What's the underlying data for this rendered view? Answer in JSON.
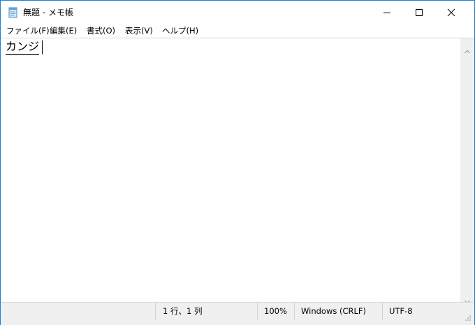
{
  "window": {
    "title": "無題 - メモ帳"
  },
  "menu": {
    "file": "ファイル(F)",
    "edit": "編集(E)",
    "format": "書式(O)",
    "view": "表示(V)",
    "help": "ヘルプ(H)"
  },
  "editor": {
    "content": "カンジ"
  },
  "status": {
    "position": "1 行、1 列",
    "zoom": "100%",
    "line_ending": "Windows (CRLF)",
    "encoding": "UTF-8"
  },
  "icons": {
    "app": "notepad-icon",
    "minimize": "minimize-icon",
    "maximize": "maximize-icon",
    "close": "close-icon",
    "scroll_up": "chevron-up-icon",
    "scroll_down": "chevron-down-icon",
    "resize_grip": "resize-grip-icon"
  },
  "colors": {
    "window_border": "#1e7fd6",
    "chrome_bg": "#f0f0f0"
  }
}
